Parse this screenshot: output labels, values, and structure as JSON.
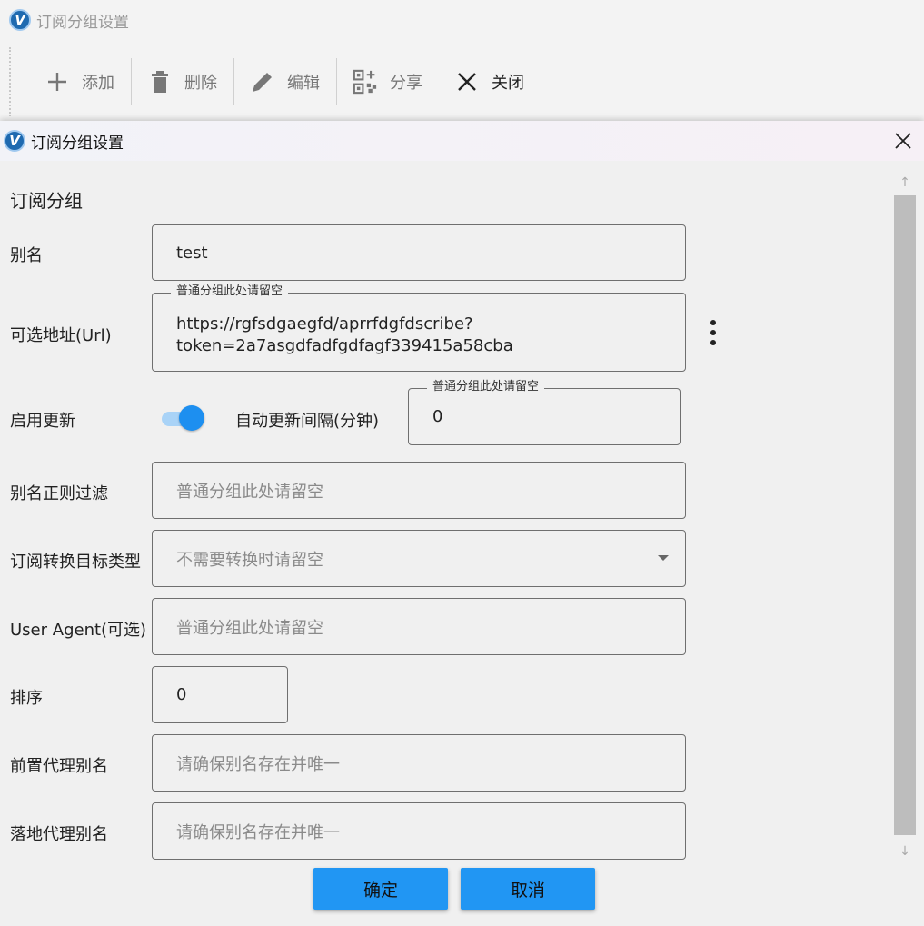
{
  "background_window": {
    "title": "订阅分组设置",
    "toolbar": {
      "add_label": "添加",
      "delete_label": "删除",
      "edit_label": "编辑",
      "share_label": "分享",
      "close_label": "关闭"
    }
  },
  "dialog": {
    "title": "订阅分组设置",
    "section_title": "订阅分组",
    "fields": {
      "alias": {
        "label": "别名",
        "value": "test"
      },
      "url": {
        "label": "可选地址(Url)",
        "legend": "普通分组此处请留空",
        "value_line1": "https://rgfsdgaegfd/aprrfdgfdscribe?",
        "value_line2": "token=2a7asgdfadfgdfagf339415a58cba"
      },
      "enable_update": {
        "label": "启用更新",
        "enabled": true
      },
      "auto_update_interval": {
        "label": "自动更新间隔(分钟)",
        "legend": "普通分组此处请留空",
        "value": "0"
      },
      "alias_regex_filter": {
        "label": "别名正则过滤",
        "placeholder": "普通分组此处请留空"
      },
      "convert_target": {
        "label": "订阅转换目标类型",
        "placeholder": "不需要转换时请留空"
      },
      "user_agent": {
        "label": "User Agent(可选)",
        "placeholder": "普通分组此处请留空"
      },
      "sort": {
        "label": "排序",
        "value": "0"
      },
      "prev_proxy_alias": {
        "label": "前置代理别名",
        "placeholder": "请确保别名存在并唯一"
      },
      "landing_proxy_alias": {
        "label": "落地代理别名",
        "placeholder": "请确保别名存在并唯一"
      }
    },
    "buttons": {
      "ok": "确定",
      "cancel": "取消"
    }
  },
  "colors": {
    "accent": "#2196f3",
    "toggle_thumb": "#1d8ff0",
    "toggle_track": "#a9d3f7"
  },
  "icons": [
    "logo-icon",
    "plus-icon",
    "trash-icon",
    "pencil-icon",
    "qr-code-icon",
    "close-icon",
    "more-vertical-icon",
    "chevron-down-icon",
    "arrow-up-icon",
    "arrow-down-icon"
  ]
}
